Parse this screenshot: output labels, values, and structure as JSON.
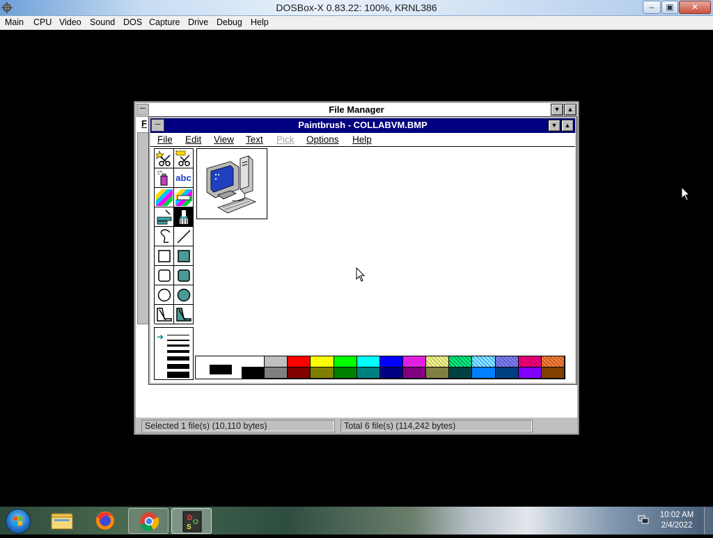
{
  "host": {
    "title": "DOSBox-X 0.83.22: 100%, KRNL386",
    "menu": [
      "Main",
      "CPU",
      "Video",
      "Sound",
      "DOS",
      "Capture",
      "Drive",
      "Debug",
      "Help"
    ],
    "buttons": {
      "minimize": "–",
      "maximize": "▣",
      "close": "✕"
    }
  },
  "file_manager": {
    "title": "File Manager",
    "menu_fragment": "F",
    "status_selected": "Selected 1 file(s) (10,110 bytes)",
    "status_total": "Total 6 file(s) (114,242 bytes)"
  },
  "paintbrush": {
    "title": "Paintbrush - COLLABVM.BMP",
    "menu": [
      {
        "key": "file",
        "label": "File",
        "enabled": true
      },
      {
        "key": "edit",
        "label": "Edit",
        "enabled": true
      },
      {
        "key": "view",
        "label": "View",
        "enabled": true
      },
      {
        "key": "text",
        "label": "Text",
        "enabled": true
      },
      {
        "key": "pick",
        "label": "Pick",
        "enabled": false
      },
      {
        "key": "options",
        "label": "Options",
        "enabled": true
      },
      {
        "key": "help",
        "label": "Help",
        "enabled": true
      }
    ],
    "tools": [
      {
        "name": "scissors-select-tool",
        "icon": "scissors-star-icon"
      },
      {
        "name": "pick-select-tool",
        "icon": "scissors-box-icon"
      },
      {
        "name": "airbrush-tool",
        "icon": "airbrush-icon"
      },
      {
        "name": "text-tool",
        "icon": "text-abc-icon",
        "label": "abc"
      },
      {
        "name": "color-eraser-tool",
        "icon": "color-eraser-icon"
      },
      {
        "name": "eraser-tool",
        "icon": "eraser-icon"
      },
      {
        "name": "paint-roller-tool",
        "icon": "paint-roller-icon"
      },
      {
        "name": "brush-tool",
        "icon": "brush-icon",
        "selected": true
      },
      {
        "name": "curve-tool",
        "icon": "curve-icon"
      },
      {
        "name": "line-tool",
        "icon": "line-icon"
      },
      {
        "name": "box-tool",
        "icon": "box-outline-icon"
      },
      {
        "name": "filled-box-tool",
        "icon": "box-filled-icon"
      },
      {
        "name": "rounded-box-tool",
        "icon": "rounded-box-outline-icon"
      },
      {
        "name": "filled-rounded-box-tool",
        "icon": "rounded-box-filled-icon"
      },
      {
        "name": "circle-tool",
        "icon": "circle-outline-icon"
      },
      {
        "name": "filled-circle-tool",
        "icon": "circle-filled-icon"
      },
      {
        "name": "polygon-tool",
        "icon": "polygon-outline-icon"
      },
      {
        "name": "filled-polygon-tool",
        "icon": "polygon-filled-icon"
      }
    ],
    "line_widths": [
      1,
      2,
      3,
      4,
      6,
      8,
      10
    ],
    "selected_line_width": 1,
    "foreground_color": "#000000",
    "background_color": "#ffffff",
    "palette_top": [
      "#ffffff",
      "#c0c0c0",
      "#ff0000",
      "#ffff00",
      "#00ff00",
      "#00ffff",
      "#0000ff",
      "#ff00ff",
      "#ffff80",
      "#00ff80",
      "#80ffff",
      "#8080ff",
      "#ff0080",
      "#ff8040"
    ],
    "palette_bottom": [
      "#000000",
      "#808080",
      "#800000",
      "#808000",
      "#008000",
      "#008080",
      "#000080",
      "#800080",
      "#808040",
      "#004040",
      "#0080ff",
      "#004080",
      "#8000ff",
      "#804000"
    ],
    "palette_dither_overlay": [
      "#ffffff",
      "#c0c0c0",
      "#c00040",
      "#c0c000",
      "#00c040",
      "#40c0c0",
      "#2020c0",
      "#c040c0",
      "#c0c080",
      "#00a060",
      "#60a0ff",
      "#6060c0",
      "#c00060",
      "#c06020"
    ]
  },
  "taskbar": {
    "apps": [
      "windows-explorer",
      "firefox",
      "chrome",
      "dosbox-x"
    ],
    "clock_time": "10:02 AM",
    "clock_date": "2/4/2022"
  },
  "colors": {
    "pb_title_active": "#000080",
    "win31_face": "#c0c0c0",
    "desktop_dos": "#000000"
  }
}
